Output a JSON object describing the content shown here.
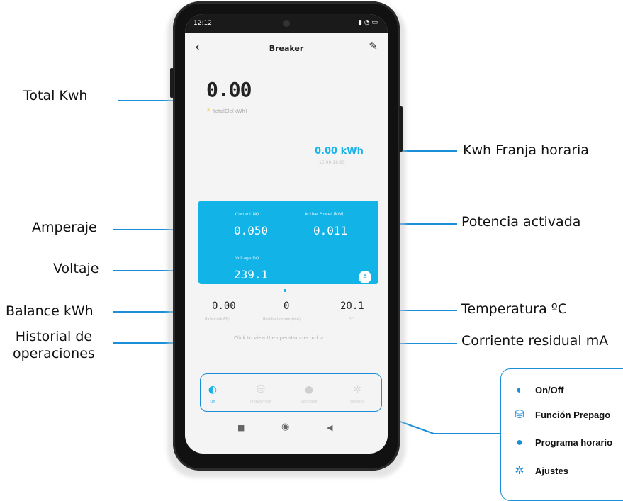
{
  "callouts": {
    "total_kwh": "Total Kwh",
    "amperaje": "Amperaje",
    "voltaje": "Voltaje",
    "balance": "Balance kWh",
    "historial_line1": "Historial de",
    "historial_line2": "operaciones",
    "franja": "Kwh Franja horaria",
    "potencia": "Potencia activada",
    "temperatura": "Temperatura ºC",
    "residual": "Corriente residual mA"
  },
  "phone": {
    "status_time": "12:12",
    "status_icons": "▮ ◔ ▭",
    "app_title": "Breaker",
    "total_value": "0.00",
    "total_label": "totalEle(kWh)",
    "franja_value": "0.00 kWh",
    "franja_date": "15:00-16:00",
    "card": {
      "current_label": "Current (A)",
      "current_value": "0.050",
      "power_label": "Active Power (kW)",
      "power_value": "0.011",
      "voltage_label": "Voltage (V)",
      "voltage_value": "239.1",
      "a_button": "A"
    },
    "stats": {
      "balance_value": "0.00",
      "balance_label": "Balance(kWh)",
      "residual_value": "0",
      "residual_label": "Residual current(mA)",
      "temp_value": "20.1",
      "temp_label": "°C"
    },
    "history_link": "Click to view the operation record >",
    "nav": [
      {
        "icon": "toggle-icon",
        "label": "On"
      },
      {
        "icon": "coins-icon",
        "label": "Prepayment"
      },
      {
        "icon": "clock-icon",
        "label": "Schedule"
      },
      {
        "icon": "settings-icon",
        "label": "Settings"
      }
    ]
  },
  "legend": {
    "items": [
      {
        "icon": "toggle-icon",
        "label": "On/Off"
      },
      {
        "icon": "coins-icon",
        "label": "Función Prepago"
      },
      {
        "icon": "clock-icon",
        "label": "Programa horario"
      },
      {
        "icon": "gear-icon",
        "label": "Ajustes"
      }
    ]
  },
  "colors": {
    "accent": "#1a8fd8",
    "card_blue": "#12b4e8"
  }
}
